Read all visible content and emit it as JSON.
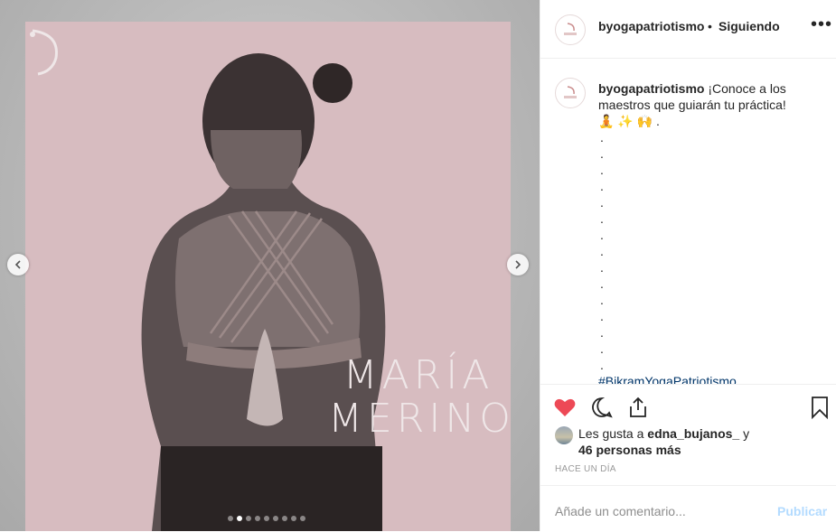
{
  "post": {
    "username": "byogapatriotismo",
    "separator": "•",
    "follow_status": "Siguiendo",
    "more_label": "•••",
    "image_text": {
      "first_name": "MARÍA",
      "last_name": "MERINO"
    },
    "carousel": {
      "total": 9,
      "active_index": 1
    }
  },
  "caption": {
    "username": "byogapatriotismo",
    "text": "¡Conoce a los maestros que guiarán tu práctica!",
    "emojis": "🧘 ✨ 🙌 .",
    "dots": [
      ".",
      ".",
      ".",
      ".",
      ".",
      ".",
      ".",
      ".",
      ".",
      ".",
      ".",
      ".",
      ".",
      ".",
      "."
    ],
    "hashtag": "#BikramYogaPatriotismo"
  },
  "likes": {
    "prefix": "Les gusta a",
    "user": "edna_bujanos_",
    "conjunction": "y",
    "others": "46 personas más"
  },
  "timestamp": "HACE UN DÍA",
  "comment": {
    "placeholder": "Añade un comentario...",
    "publish_label": "Publicar"
  },
  "colors": {
    "like_red": "#ed4956",
    "publish_blue": "#b3dbff",
    "poster_pink": "#d7bcc0"
  }
}
